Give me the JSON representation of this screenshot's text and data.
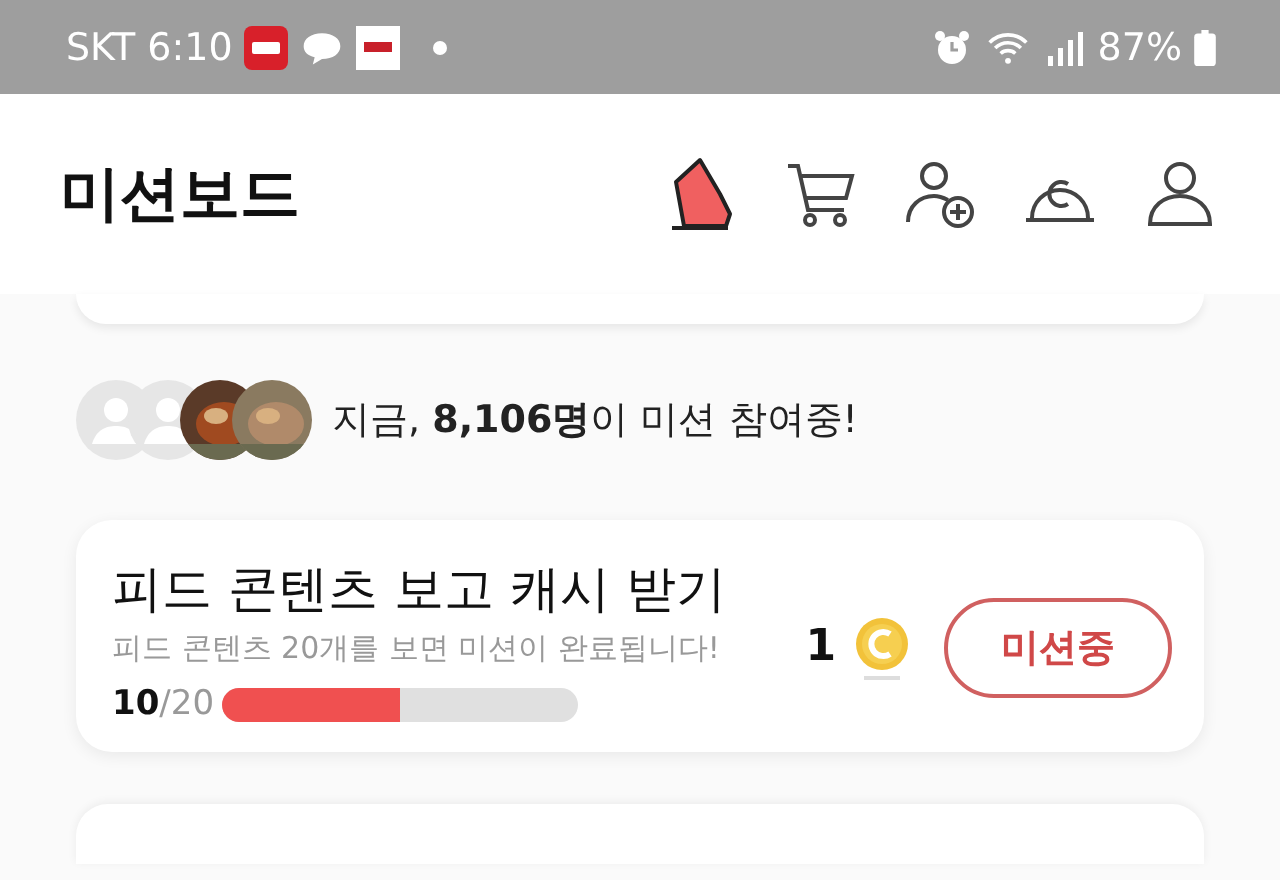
{
  "status_bar": {
    "carrier": "SKT",
    "time": "6:10",
    "battery": "87%"
  },
  "header": {
    "title": "미션보드"
  },
  "participation": {
    "avatars": [
      {
        "kind": "placeholder"
      },
      {
        "kind": "placeholder"
      },
      {
        "kind": "picture"
      },
      {
        "kind": "picture"
      }
    ],
    "text": "지금, **8,106명**이 미션 참여중!"
  },
  "mission": {
    "title": "피드 콘텐츠 보고 캐시 받기",
    "description": "피드 콘텐츠 20개를 보면 미션이 완료됩니다!",
    "reward": "1",
    "button": "미션중",
    "progress": {
      "current": "10",
      "total": "/20",
      "level": 0.5
    }
  }
}
